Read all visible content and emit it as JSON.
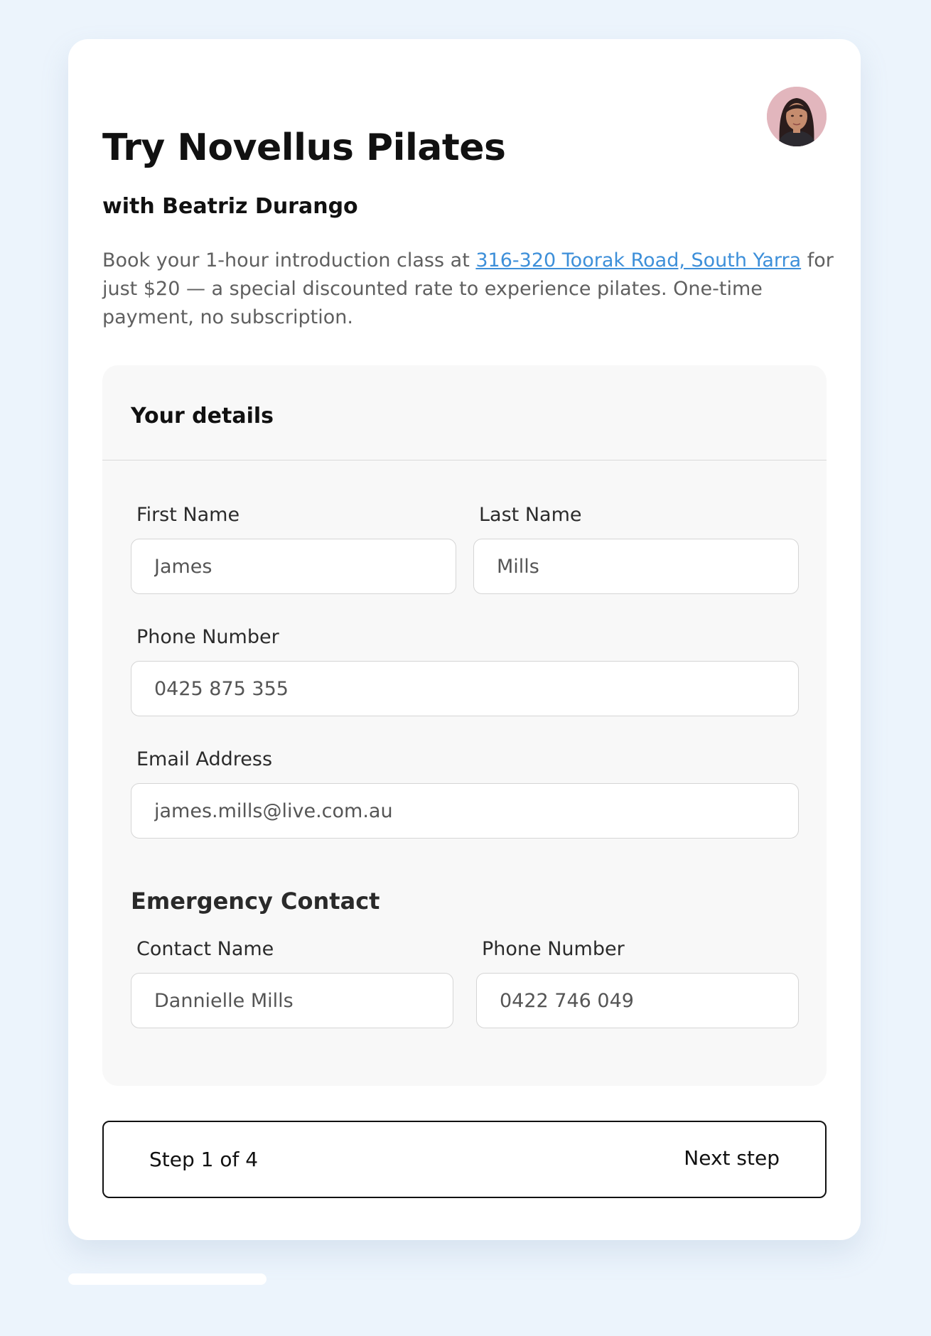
{
  "header": {
    "title": "Try Novellus Pilates",
    "subtitle": "with Beatriz Durango",
    "instructor_avatar": "woman-portrait"
  },
  "intro": {
    "before_link": "Book your 1-hour introduction class at ",
    "link_text": "316-320 Toorak Road, South Yarra",
    "after_link": " for just $20 — a special discounted rate to experience pilates. One-time payment, no subscription."
  },
  "details": {
    "heading": "Your details",
    "first_name": {
      "label": "First Name",
      "value": "James"
    },
    "last_name": {
      "label": "Last Name",
      "value": "Mills"
    },
    "phone": {
      "label": "Phone Number",
      "value": "0425 875 355"
    },
    "email": {
      "label": "Email Address",
      "value": "james.mills@live.com.au"
    }
  },
  "emergency": {
    "heading": "Emergency Contact",
    "contact_name": {
      "label": "Contact Name",
      "value": "Dannielle Mills"
    },
    "contact_phone": {
      "label": "Phone Number",
      "value": "0422 746 049"
    }
  },
  "footer": {
    "step_text": "Step 1 of 4",
    "next_label": "Next step"
  },
  "progress": {
    "fraction": 0.25
  },
  "colors": {
    "background": "#ecf4fc",
    "link": "#3d8fd9",
    "panel": "#f8f8f8"
  }
}
